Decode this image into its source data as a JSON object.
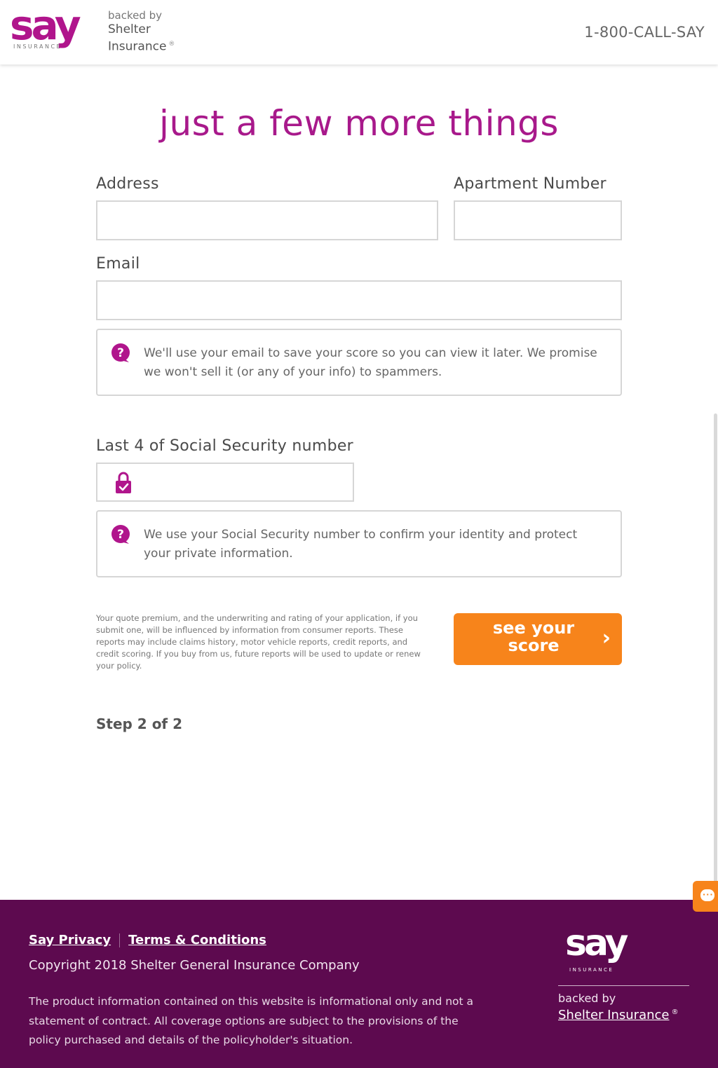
{
  "header": {
    "logo_word": "say",
    "logo_sub": "INSURANCE",
    "backed_by": "backed by",
    "partner_line1": "Shelter",
    "partner_line2": "Insurance",
    "registered": "®",
    "phone": "1-800-CALL-SAY"
  },
  "page": {
    "title": "just a few more things"
  },
  "form": {
    "address": {
      "label": "Address",
      "value": ""
    },
    "apartment": {
      "label": "Apartment Number",
      "value": ""
    },
    "email": {
      "label": "Email",
      "value": "",
      "help": "We'll use your email to save your score so you can view it later. We promise we won't sell it (or any of your info) to spammers."
    },
    "ssn": {
      "label": "Last 4 of Social Security number",
      "value": "",
      "help": "We use your Social Security number to confirm your identity and protect your private information."
    }
  },
  "disclaimer": "Your quote premium, and the underwriting and rating of your application, if you submit one, will be influenced by information from consumer reports. These reports may include claims history, motor vehicle reports, credit reports, and credit scoring. If you buy from us, future reports will be used to update or renew your policy.",
  "cta": {
    "label": "see your score",
    "chevron": "›"
  },
  "step": "Step 2 of 2",
  "footer": {
    "privacy_link": "Say Privacy",
    "terms_link": "Terms & Conditions",
    "copyright": "Copyright 2018 Shelter General Insurance Company",
    "disclaimer": "The product information contained on this website is informational only and not a statement of contract. All coverage options are subject to the provisions of the policy purchased and details of the policyholder's situation.",
    "logo_word": "say",
    "logo_sub": "INSURANCE",
    "backed_by": "backed by",
    "partner": "Shelter Insurance",
    "registered": "®"
  },
  "colors": {
    "brand": "#a8198b",
    "accent": "#f7841b",
    "footer_bg": "#5d0a4f"
  },
  "icons": [
    "help-question-icon",
    "lock-check-icon",
    "chevron-right-icon",
    "chat-icon"
  ]
}
